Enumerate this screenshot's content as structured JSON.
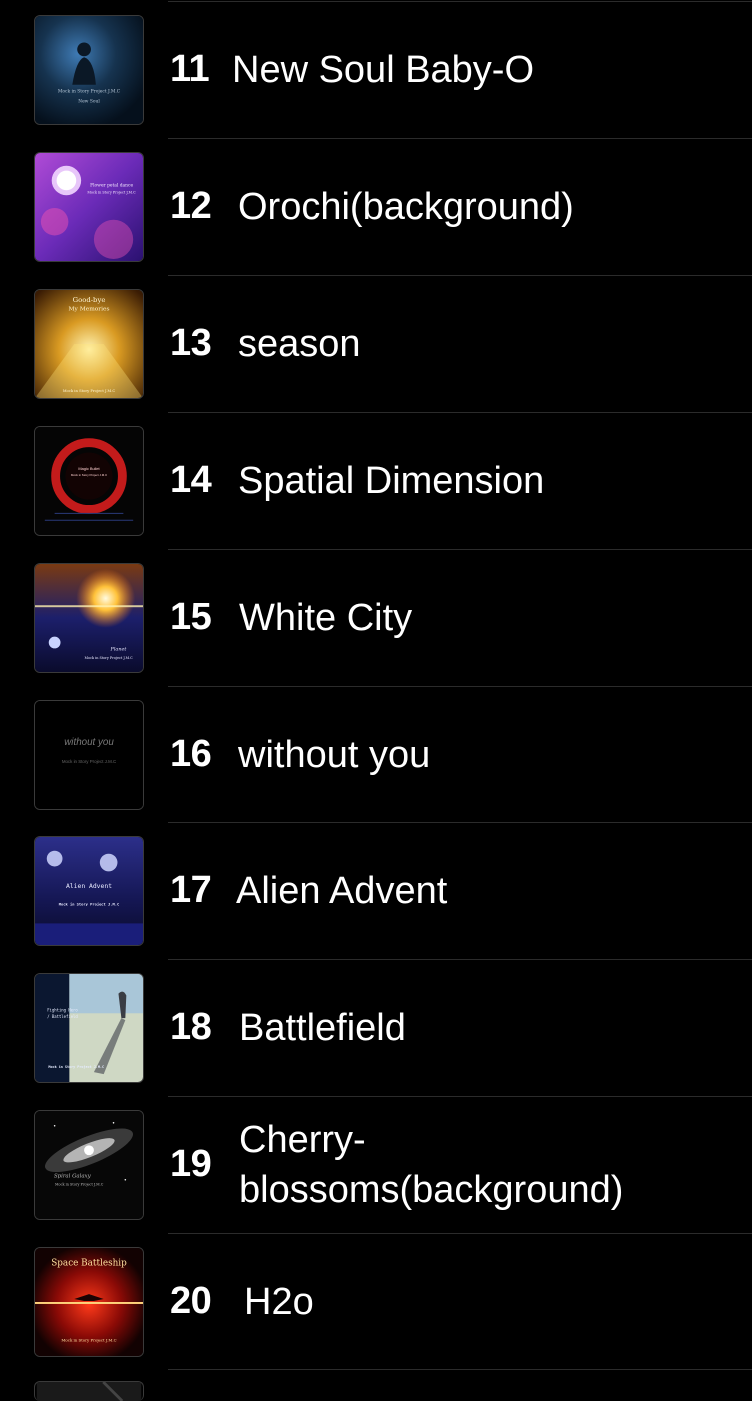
{
  "tracks": [
    {
      "number": "11",
      "title": "New Soul Baby-O",
      "art_text": [
        "Mock in Story Project J.M.C",
        "New Soul"
      ]
    },
    {
      "number": "12",
      "title": "Orochi(background)",
      "art_text": [
        "Flower petal dance",
        "Mock in Story Project J.M.C"
      ]
    },
    {
      "number": "13",
      "title": "season",
      "art_text": [
        "Good-bye",
        "My Memories",
        "Mock in Story Project J.M.C"
      ]
    },
    {
      "number": "14",
      "title": "Spatial Dimension",
      "art_text": [
        "Magic Bullet",
        "Mock in Story Project J.M.C"
      ]
    },
    {
      "number": "15",
      "title": "White City",
      "art_text": [
        "Planet",
        "Mock in Story Project J.M.C"
      ]
    },
    {
      "number": "16",
      "title": "without you",
      "art_text": [
        "without you",
        "Mock in Story Project J.M.C"
      ]
    },
    {
      "number": "17",
      "title": "Alien Advent",
      "art_text": [
        "Alien Advent",
        "Mock in Story Project J.M.C"
      ]
    },
    {
      "number": "18",
      "title": "Battlefield",
      "art_text": [
        "Fighting Hero",
        "/ Battlefield",
        "Mock in Story Project J.M.C"
      ]
    },
    {
      "number": "19",
      "title": "Cherry-blossoms(background)",
      "art_text": [
        "Spiral Galaxy",
        "Mock in Story Project J.M.C"
      ]
    },
    {
      "number": "20",
      "title": "H2o",
      "art_text": [
        "Space Battleship",
        "Mock in Story Project J.M.C"
      ]
    }
  ]
}
